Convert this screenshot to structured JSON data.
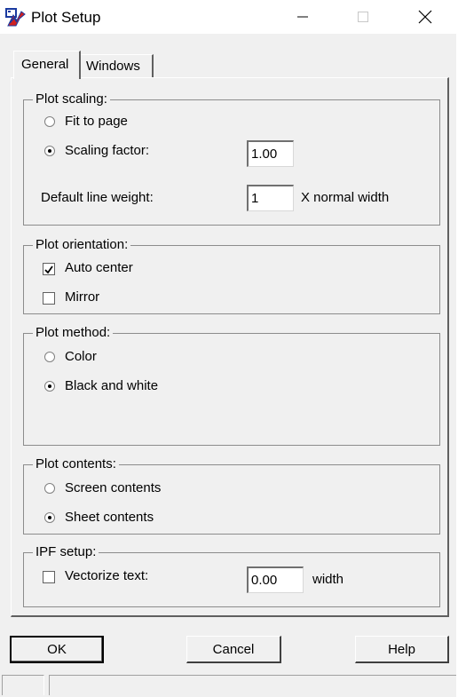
{
  "window": {
    "title": "Plot Setup",
    "app_icon": "plot-app-icon",
    "minimize_icon": "minimize-icon",
    "maximize_icon": "maximize-icon",
    "close_icon": "close-icon"
  },
  "tabs": [
    {
      "label": "General",
      "selected": true
    },
    {
      "label": "Windows",
      "selected": false
    }
  ],
  "plot_scaling": {
    "label": "Plot scaling:",
    "fit_to_page": {
      "label": "Fit to page",
      "selected": false
    },
    "scaling_factor": {
      "label": "Scaling factor:",
      "selected": true,
      "value": "1.00"
    },
    "default_line_weight": {
      "label": "Default line weight:",
      "value": "1",
      "suffix": "X normal width"
    }
  },
  "plot_orientation": {
    "label": "Plot orientation:",
    "auto_center": {
      "label": "Auto center",
      "checked": true
    },
    "mirror": {
      "label": "Mirror",
      "checked": false
    }
  },
  "plot_method": {
    "label": "Plot method:",
    "color": {
      "label": "Color",
      "selected": false
    },
    "black_and_white": {
      "label": "Black and white",
      "selected": true
    }
  },
  "plot_contents": {
    "label": "Plot contents:",
    "screen_contents": {
      "label": "Screen contents",
      "selected": false
    },
    "sheet_contents": {
      "label": "Sheet contents",
      "selected": true
    }
  },
  "ipf_setup": {
    "label": "IPF setup:",
    "vectorize_text": {
      "label": "Vectorize text:",
      "checked": false
    },
    "width_value": "0.00",
    "width_label": "width"
  },
  "buttons": {
    "ok": "OK",
    "cancel": "Cancel",
    "help": "Help"
  },
  "colors": {
    "window_bg": "#f0f0f0",
    "titlebar_bg": "#ffffff",
    "icon_red": "#d02020",
    "icon_blue": "#1a3aa0"
  }
}
